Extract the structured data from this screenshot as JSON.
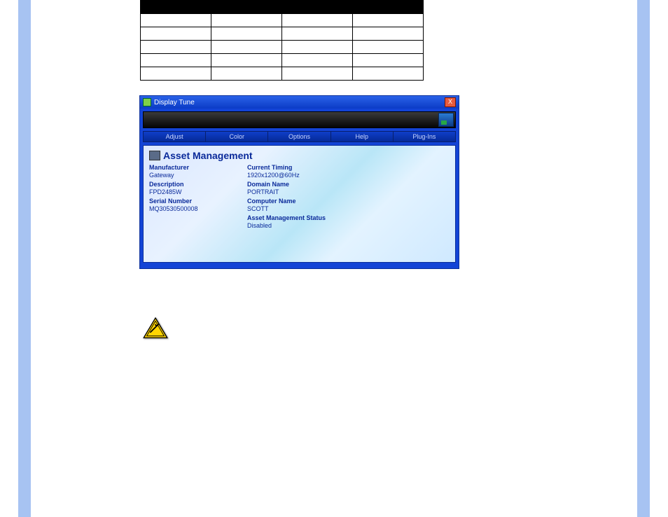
{
  "table": {
    "headers": [
      "",
      "",
      "",
      ""
    ],
    "rows": [
      [
        "",
        "",
        "",
        ""
      ],
      [
        "",
        "",
        "",
        ""
      ],
      [
        "",
        "",
        "",
        ""
      ],
      [
        "",
        "",
        "",
        ""
      ],
      [
        "",
        "",
        "",
        ""
      ]
    ]
  },
  "window": {
    "title": "Display Tune",
    "close_glyph": "X",
    "menu": {
      "adjust": "Adjust",
      "color": "Color",
      "options": "Options",
      "help": "Help",
      "plugins": "Plug-Ins"
    },
    "panel": {
      "heading": "Asset Management",
      "left": {
        "manufacturer_label": "Manufacturer",
        "manufacturer_value": "Gateway",
        "description_label": "Description",
        "description_value": "FPD2485W",
        "serial_label": "Serial Number",
        "serial_value": "MQ30530500008"
      },
      "right": {
        "timing_label": "Current Timing",
        "timing_value": "1920x1200@60Hz",
        "domain_label": "Domain Name",
        "domain_value": "PORTRAIT",
        "computer_label": "Computer Name",
        "computer_value": "SCOTT",
        "status_label": "Asset Management Status",
        "status_value": "Disabled"
      }
    }
  },
  "caution_alt": "Caution"
}
